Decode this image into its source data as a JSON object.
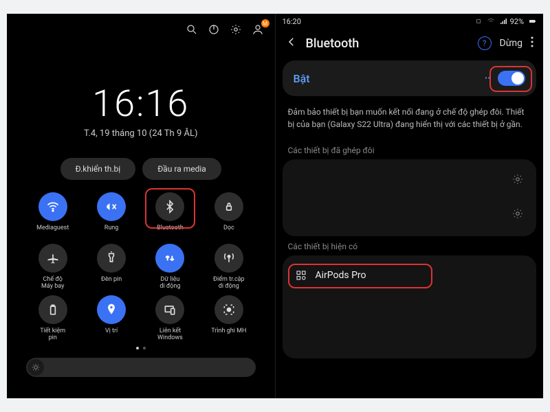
{
  "left": {
    "topbar_badge": "M",
    "clock": {
      "time": "16:16",
      "date": "T.4, 19 tháng 10 (24 Th 9 ÂL)"
    },
    "pills": {
      "devices": "Đ.khiển th.bị",
      "media": "Đầu ra media"
    },
    "qs": {
      "wifi": "Mediaguest",
      "sound": "Rung",
      "bt": "Bluetooth",
      "rotate": "Dọc",
      "airplane": "Chế độ\nMáy bay",
      "flash": "Đèn pin",
      "data": "Dữ liệu\ndi động",
      "hotspot": "Điểm tr.cập\ndi động",
      "battery": "Tiết kiệm\npin",
      "location": "Vị trí",
      "link": "Liên kết\nWindows",
      "record": "Trình ghi MH"
    }
  },
  "right": {
    "status": {
      "time": "16:20",
      "battery": "92%"
    },
    "header": {
      "title": "Bluetooth",
      "stop": "Dừng"
    },
    "toggle": {
      "label": "Bật"
    },
    "desc": "Đảm bảo thiết bị bạn muốn kết nối đang ở chế độ ghép đôi. Thiết bị của bạn (Galaxy S22 Ultra) đang hiển thị với các thiết bị ở gần.",
    "sections": {
      "paired": "Các thiết bị đã ghép đôi",
      "available": "Các thiết bị hiện có"
    },
    "available_device": "AirPods Pro"
  }
}
